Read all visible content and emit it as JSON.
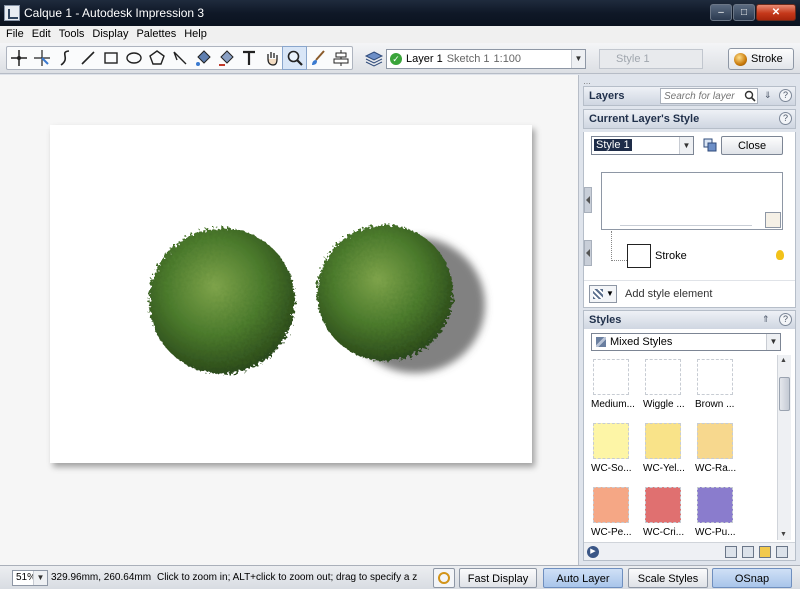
{
  "window": {
    "title": "Calque 1 - Autodesk Impression 3"
  },
  "menu": {
    "items": [
      "File",
      "Edit",
      "Tools",
      "Display",
      "Palettes",
      "Help"
    ]
  },
  "toolbar": {
    "tool_icons": [
      "crosshair-select-icon",
      "node-edit-icon",
      "curve-pen-icon",
      "line-icon",
      "rectangle-icon",
      "ellipse-icon",
      "polygon-icon",
      "knife-icon",
      "fill-bucket-icon",
      "style-bucket-icon",
      "text-icon",
      "hand-pan-icon",
      "zoom-icon",
      "brush-icon",
      "align-icon"
    ],
    "active_tool": "zoom-icon",
    "layer": {
      "name": "Layer 1",
      "sketch": "Sketch 1",
      "scale": "1:100"
    },
    "style_field": "Style 1",
    "stroke_label": "Stroke"
  },
  "panel": {
    "layers": {
      "title": "Layers",
      "search_placeholder": "Search for layer"
    },
    "current_style": {
      "title": "Current Layer's Style",
      "selected_style": "Style 1",
      "close_label": "Close",
      "element_label": "Stroke",
      "add_label": "Add style element"
    },
    "styles": {
      "title": "Styles",
      "filter": "Mixed Styles",
      "swatches": [
        {
          "label": "Medium...",
          "color": "#ffffff"
        },
        {
          "label": "Wiggle ...",
          "color": "#ffffff"
        },
        {
          "label": "Brown ...",
          "color": "#ffffff"
        },
        {
          "label": "WC-So...",
          "color": "#fdf5a6"
        },
        {
          "label": "WC-Yel...",
          "color": "#f9e389"
        },
        {
          "label": "WC-Ra...",
          "color": "#f7d88e"
        },
        {
          "label": "WC-Pe...",
          "color": "#f5a785"
        },
        {
          "label": "WC-Cri...",
          "color": "#e07070"
        },
        {
          "label": "WC-Pu...",
          "color": "#8a7ccd"
        }
      ]
    }
  },
  "statusbar": {
    "zoom": "51%",
    "coords": "329.96mm, 260.64mm",
    "hint": "Click to zoom in; ALT+click to zoom out; drag to specify a zo...",
    "buttons": {
      "fast_display": "Fast Display",
      "auto_layer": "Auto Layer",
      "scale_styles": "Scale Styles",
      "osnap": "OSnap"
    }
  }
}
